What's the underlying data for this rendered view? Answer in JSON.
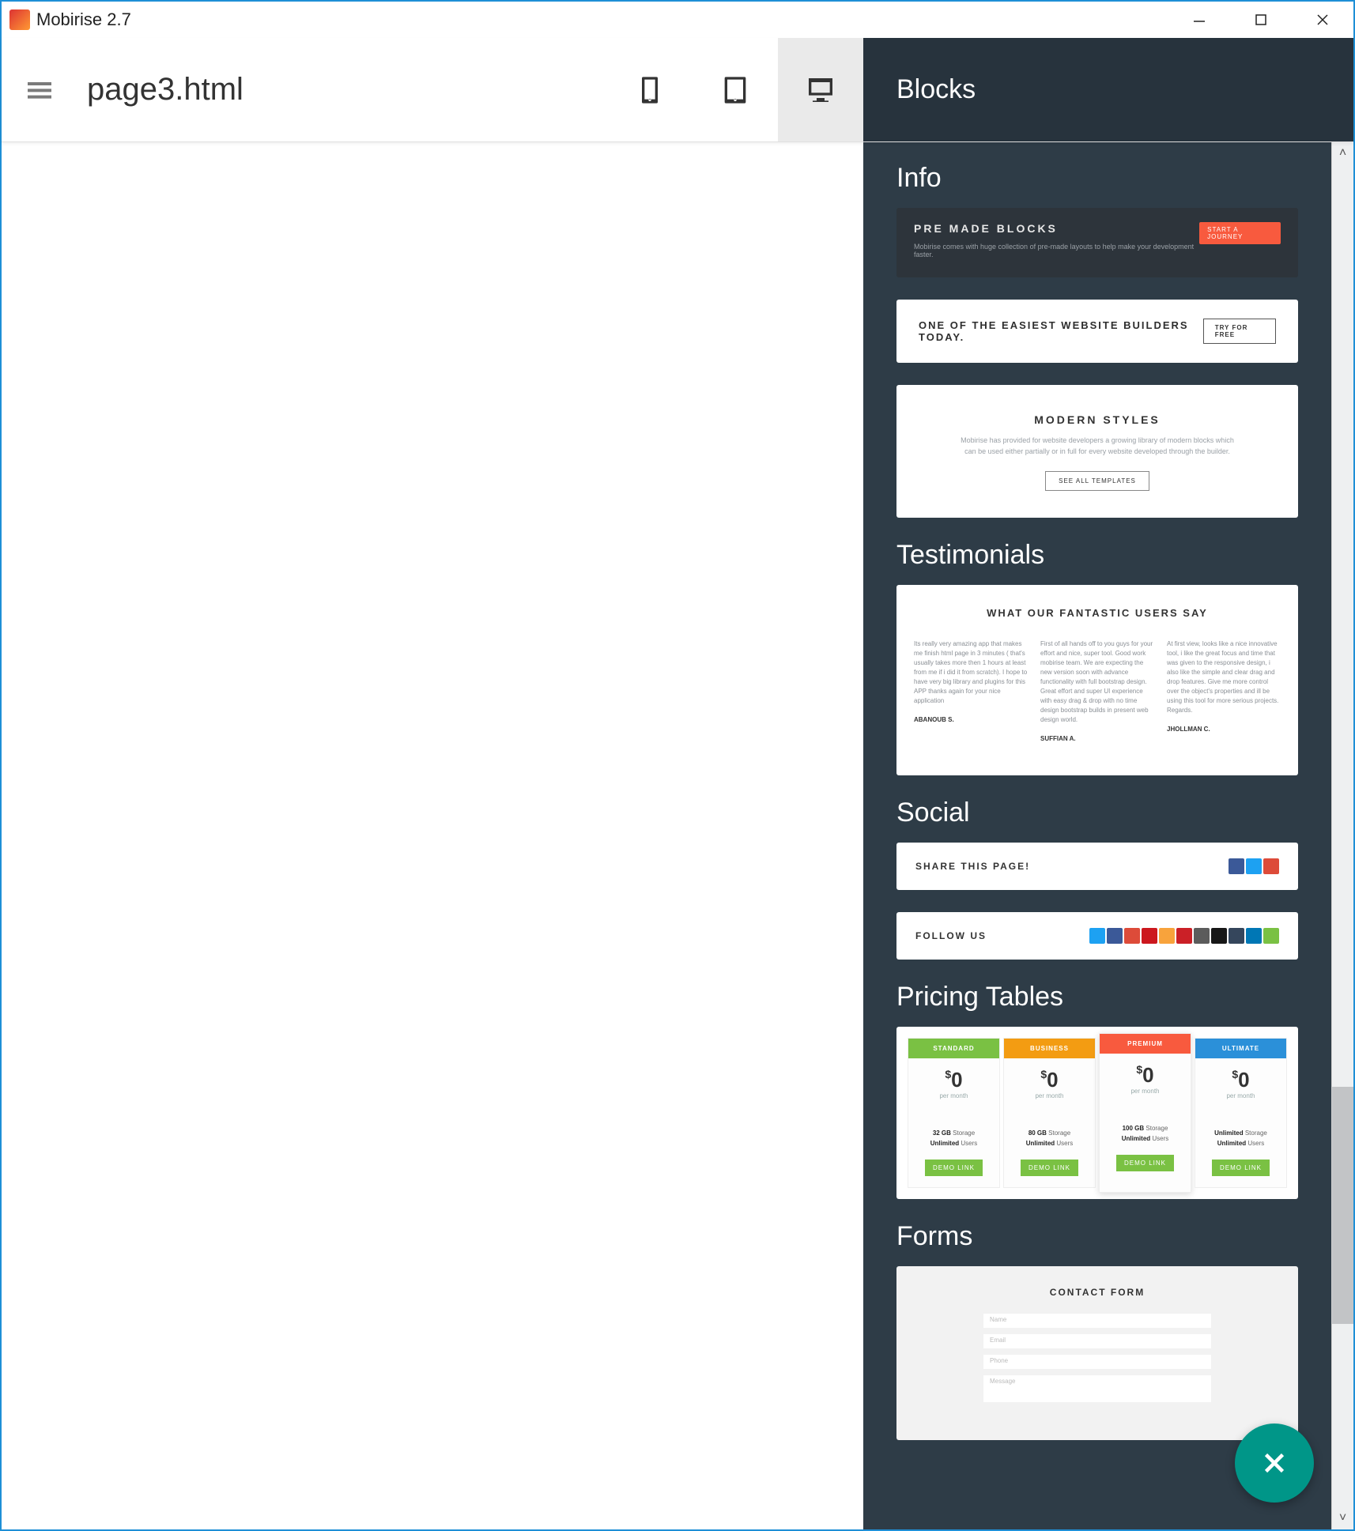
{
  "window": {
    "title": "Mobirise 2.7"
  },
  "toolbar": {
    "pageName": "page3.html",
    "activeDevice": "desktop"
  },
  "panel": {
    "title": "Blocks",
    "sections": {
      "info": {
        "title": "Info",
        "block1": {
          "heading": "PRE MADE BLOCKS",
          "subtext": "Mobirise comes with huge collection of pre-made layouts to help make your development faster.",
          "button": "START A JOURNEY"
        },
        "block2": {
          "heading": "ONE OF THE EASIEST WEBSITE BUILDERS TODAY.",
          "button": "TRY FOR FREE"
        },
        "block3": {
          "heading": "MODERN STYLES",
          "body": "Mobirise has provided for website developers a growing library of modern blocks which can be used either partially or in full for every website developed through the builder.",
          "button": "SEE ALL TEMPLATES"
        }
      },
      "testimonials": {
        "title": "Testimonials",
        "heading": "WHAT OUR FANTASTIC USERS SAY",
        "cols": [
          {
            "quote": "Its really very amazing app that makes me finish html page in 3 minutes ( that's usually takes more then 1 hours at least from me if i did it from scratch). I hope to have very big library and plugins for this APP thanks again for your nice application",
            "author": "ABANOUB S."
          },
          {
            "quote": "First of all hands off to you guys for your effort and nice, super tool. Good work mobirise team. We are expecting the new version soon with advance functionality with full bootstrap design. Great effort and super UI experience with easy drag & drop with no time design bootstrap builds in present web design world.",
            "author": "SUFFIAN A."
          },
          {
            "quote": "At first view, looks like a nice innovative tool, i like the great focus and time that was given to the responsive design, i also like the simple and clear drag and drop features. Give me more control over the object's properties and ill be using this tool for more serious projects. Regards.",
            "author": "JHOLLMAN C."
          }
        ]
      },
      "social": {
        "title": "Social",
        "share": {
          "label": "SHARE THIS PAGE!",
          "icons": [
            "#3b5998",
            "#1da1f2",
            "#dd4b39"
          ]
        },
        "follow": {
          "label": "FOLLOW US",
          "icons": [
            "#1da1f2",
            "#3b5998",
            "#dd4b39",
            "#cc181e",
            "#f8a33c",
            "#cb2027",
            "#5c5c5c",
            "#171717",
            "#35465c",
            "#0077b5",
            "#7ac143"
          ]
        }
      },
      "pricing": {
        "title": "Pricing Tables",
        "plans": [
          {
            "name": "STANDARD",
            "color": "#7ac143",
            "price": "0",
            "per": "per month",
            "feat1b": "32 GB",
            "feat1": "Storage",
            "feat2b": "Unlimited",
            "feat2": "Users",
            "button": "DEMO LINK"
          },
          {
            "name": "BUSINESS",
            "color": "#f39c12",
            "price": "0",
            "per": "per month",
            "feat1b": "80 GB",
            "feat1": "Storage",
            "feat2b": "Unlimited",
            "feat2": "Users",
            "button": "DEMO LINK"
          },
          {
            "name": "PREMIUM",
            "color": "#f85a3e",
            "price": "0",
            "per": "per month",
            "feat1b": "100 GB",
            "feat1": "Storage",
            "feat2b": "Unlimited",
            "feat2": "Users",
            "button": "DEMO LINK",
            "popular": true
          },
          {
            "name": "ULTIMATE",
            "color": "#2b90d9",
            "price": "0",
            "per": "per month",
            "feat1b": "Unlimited",
            "feat1": "Storage",
            "feat2b": "Unlimited",
            "feat2": "Users",
            "button": "DEMO LINK"
          }
        ]
      },
      "forms": {
        "title": "Forms",
        "heading": "CONTACT FORM",
        "fields": [
          "Name",
          "Email",
          "Phone",
          "Message"
        ]
      }
    }
  }
}
